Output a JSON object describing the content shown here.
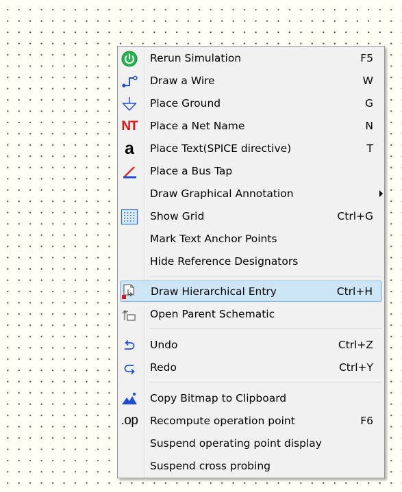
{
  "context_menu": {
    "items": [
      {
        "label": "Rerun Simulation",
        "shortcut": "F5",
        "icon": "power-icon"
      },
      {
        "label": "Draw a Wire",
        "shortcut": "W",
        "icon": "wire-icon"
      },
      {
        "label": "Place Ground",
        "shortcut": "G",
        "icon": "ground-icon"
      },
      {
        "label": "Place a Net Name",
        "shortcut": "N",
        "icon_text": "NT",
        "icon": "net-name-icon"
      },
      {
        "label": "Place Text(SPICE directive)",
        "shortcut": "T",
        "icon_text": "a",
        "icon": "text-icon"
      },
      {
        "label": "Place a Bus Tap",
        "shortcut": "",
        "icon": "bus-tap-icon"
      },
      {
        "label": "Draw Graphical Annotation",
        "shortcut": "",
        "submenu": true
      },
      {
        "label": "Show Grid",
        "shortcut": "Ctrl+G",
        "icon": "grid-icon"
      },
      {
        "label": "Mark Text Anchor Points",
        "shortcut": ""
      },
      {
        "label": "Hide Reference Designators",
        "shortcut": ""
      },
      {
        "label": "Draw Hierarchical Entry",
        "shortcut": "Ctrl+H",
        "icon": "hierarchical-entry-icon",
        "highlighted": true
      },
      {
        "label": "Open Parent Schematic",
        "shortcut": "",
        "icon": "parent-schematic-icon"
      },
      {
        "label": "Undo",
        "shortcut": "Ctrl+Z",
        "icon": "undo-icon"
      },
      {
        "label": "Redo",
        "shortcut": "Ctrl+Y",
        "icon": "redo-icon"
      },
      {
        "label": "Copy Bitmap to Clipboard",
        "shortcut": "",
        "icon": "bitmap-icon"
      },
      {
        "label": "Recompute operation point",
        "shortcut": "F6",
        "icon_text": ".op",
        "icon": "op-icon"
      },
      {
        "label": "Suspend operating point display",
        "shortcut": ""
      },
      {
        "label": "Suspend cross probing",
        "shortcut": ""
      }
    ]
  },
  "colors": {
    "canvas_background": "#fffff6",
    "menu_background": "#f1f1f1",
    "highlight_fill": "#cde6f7",
    "highlight_border": "#7ab2e0",
    "icon_blue": "#1f4fd6",
    "icon_green": "#1fb548",
    "icon_red": "#e21313"
  }
}
